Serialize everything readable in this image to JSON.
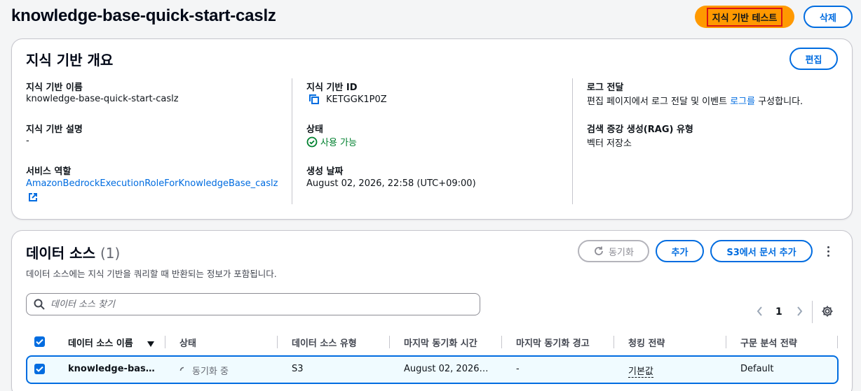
{
  "header": {
    "title": "knowledge-base-quick-start-caslz",
    "test_label": "지식 기반 테스트",
    "delete_label": "삭제"
  },
  "overview": {
    "title": "지식 기반 개요",
    "edit_label": "편집",
    "name_label": "지식 기반 이름",
    "name_value": "knowledge-base-quick-start-caslz",
    "desc_label": "지식 기반 설명",
    "desc_value": "-",
    "role_label": "서비스 역할",
    "role_value": "AmazonBedrockExecutionRoleForKnowledgeBase_caslz",
    "id_label": "지식 기반 ID",
    "id_value": "KETGGK1P0Z",
    "status_label": "상태",
    "status_value": "사용 가능",
    "created_label": "생성 날짜",
    "created_value": "August 02, 2026, 22:58 (UTC+09:00)",
    "log_label": "로그 전달",
    "log_text_before": "편집 페이지에서 로그 전달 및 이벤트 ",
    "log_link": "로그를",
    "log_text_after": " 구성합니다.",
    "rag_label": "검색 증강 생성(RAG) 유형",
    "rag_value": "벡터 저장소"
  },
  "datasources": {
    "title": "데이터 소스",
    "count": "(1)",
    "description": "데이터 소스에는 지식 기반을 쿼리할 때 반환되는 정보가 포함됩니다.",
    "sync_label": "동기화",
    "add_label": "추가",
    "s3_label": "S3에서 문서 추가",
    "search_placeholder": "데이터 소스 찾기",
    "page": "1",
    "columns": [
      "데이터 소스 이름",
      "상태",
      "데이터 소스 유형",
      "마지막 동기화 시간",
      "마지막 동기화 경고",
      "청킹 전략",
      "구문 분석 전략"
    ],
    "row": {
      "name": "knowledge-bas…",
      "status": "동기화 중",
      "type": "S3",
      "last_sync": "August 02, 2026…",
      "warning": "-",
      "chunking": "기본값",
      "parsing": "Default"
    }
  },
  "colors": {
    "accent": "#006ce0",
    "primary": "#ff9900",
    "success": "#00802f"
  }
}
